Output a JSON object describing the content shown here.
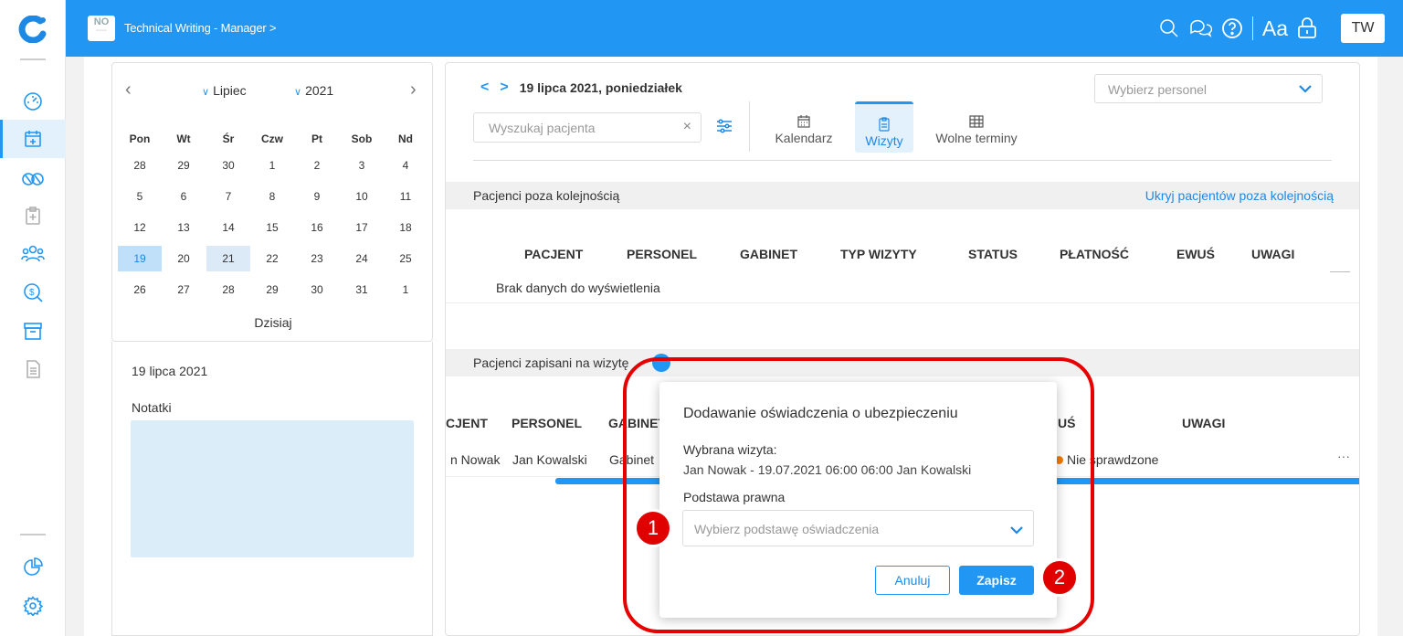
{
  "header": {
    "breadcrumb": "Technical Writing - Manager >",
    "logo_text": "NO",
    "avatar": "TW",
    "font_label": "Aa"
  },
  "calendar": {
    "month": "Lipiec",
    "year": "2021",
    "weekdays": [
      "Pon",
      "Wt",
      "Śr",
      "Czw",
      "Pt",
      "Sob",
      "Nd"
    ],
    "weeks": [
      [
        "28",
        "29",
        "30",
        "1",
        "2",
        "3",
        "4"
      ],
      [
        "5",
        "6",
        "7",
        "8",
        "9",
        "10",
        "11"
      ],
      [
        "12",
        "13",
        "14",
        "15",
        "16",
        "17",
        "18"
      ],
      [
        "19",
        "20",
        "21",
        "22",
        "23",
        "24",
        "25"
      ],
      [
        "26",
        "27",
        "28",
        "29",
        "30",
        "31",
        "1"
      ]
    ],
    "selected_day": "19",
    "today_label": "Dzisiaj"
  },
  "notes": {
    "date": "19 lipca 2021",
    "label": "Notatki"
  },
  "main": {
    "date_title": "19 lipca 2021, poniedziałek",
    "staff_placeholder": "Wybierz personel",
    "search_placeholder": "Wyszukaj pacjenta",
    "tabs": [
      {
        "label": "Kalendarz"
      },
      {
        "label": "Wizyty"
      },
      {
        "label": "Wolne terminy"
      }
    ],
    "section1": {
      "title": "Pacjenci poza kolejnością",
      "hide_link": "Ukryj pacjentów poza kolejnością",
      "columns": [
        "PACJENT",
        "PERSONEL",
        "GABINET",
        "TYP WIZYTY",
        "STATUS",
        "PŁATNOŚĆ",
        "EWUŚ",
        "UWAGI"
      ],
      "empty": "Brak danych do wyświetlenia"
    },
    "section2": {
      "title": "Pacjenci zapisani na wizytę",
      "columns": [
        "CJENT",
        "PERSONEL",
        "GABINET",
        "UŚ",
        "UWAGI"
      ],
      "row": {
        "patient": "n Nowak",
        "staff": "Jan Kowalski",
        "room": "Gabinet",
        "ewus": "Nie sprawdzone",
        "more": "···"
      }
    }
  },
  "modal": {
    "title": "Dodawanie oświadczenia o ubezpieczeniu",
    "visit_label": "Wybrana wizyta:",
    "visit_value": "Jan Nowak - 19.07.2021 06:00 06:00 Jan Kowalski",
    "legal_label": "Podstawa prawna",
    "legal_placeholder": "Wybierz podstawę oświadczenia",
    "cancel": "Anuluj",
    "save": "Zapisz"
  },
  "markers": [
    "1",
    "2"
  ],
  "colors": {
    "accent": "#2196f3",
    "highlight": "#e60000"
  }
}
